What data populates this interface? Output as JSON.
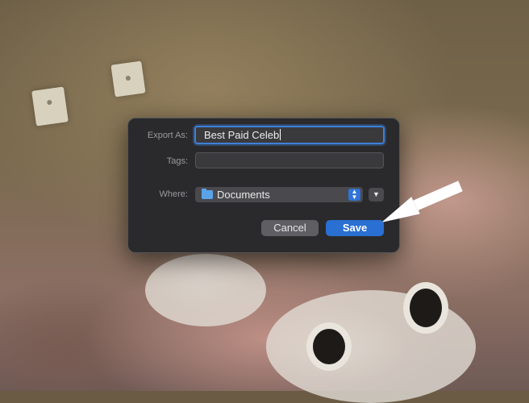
{
  "dialog": {
    "export_as_label": "Export As:",
    "export_as_value": "Best Paid Celeb",
    "tags_label": "Tags:",
    "tags_value": "",
    "where_label": "Where:",
    "where_value": "Documents",
    "cancel_label": "Cancel",
    "save_label": "Save"
  },
  "icons": {
    "folder": "folder-icon",
    "stepper": "up-down-chevron-icon",
    "expand": "chevron-down-icon",
    "annotation": "arrow-icon"
  },
  "colors": {
    "accent": "#2a6fd2",
    "dialog_bg": "#2a2a2c",
    "arrow": "#ffffff"
  }
}
